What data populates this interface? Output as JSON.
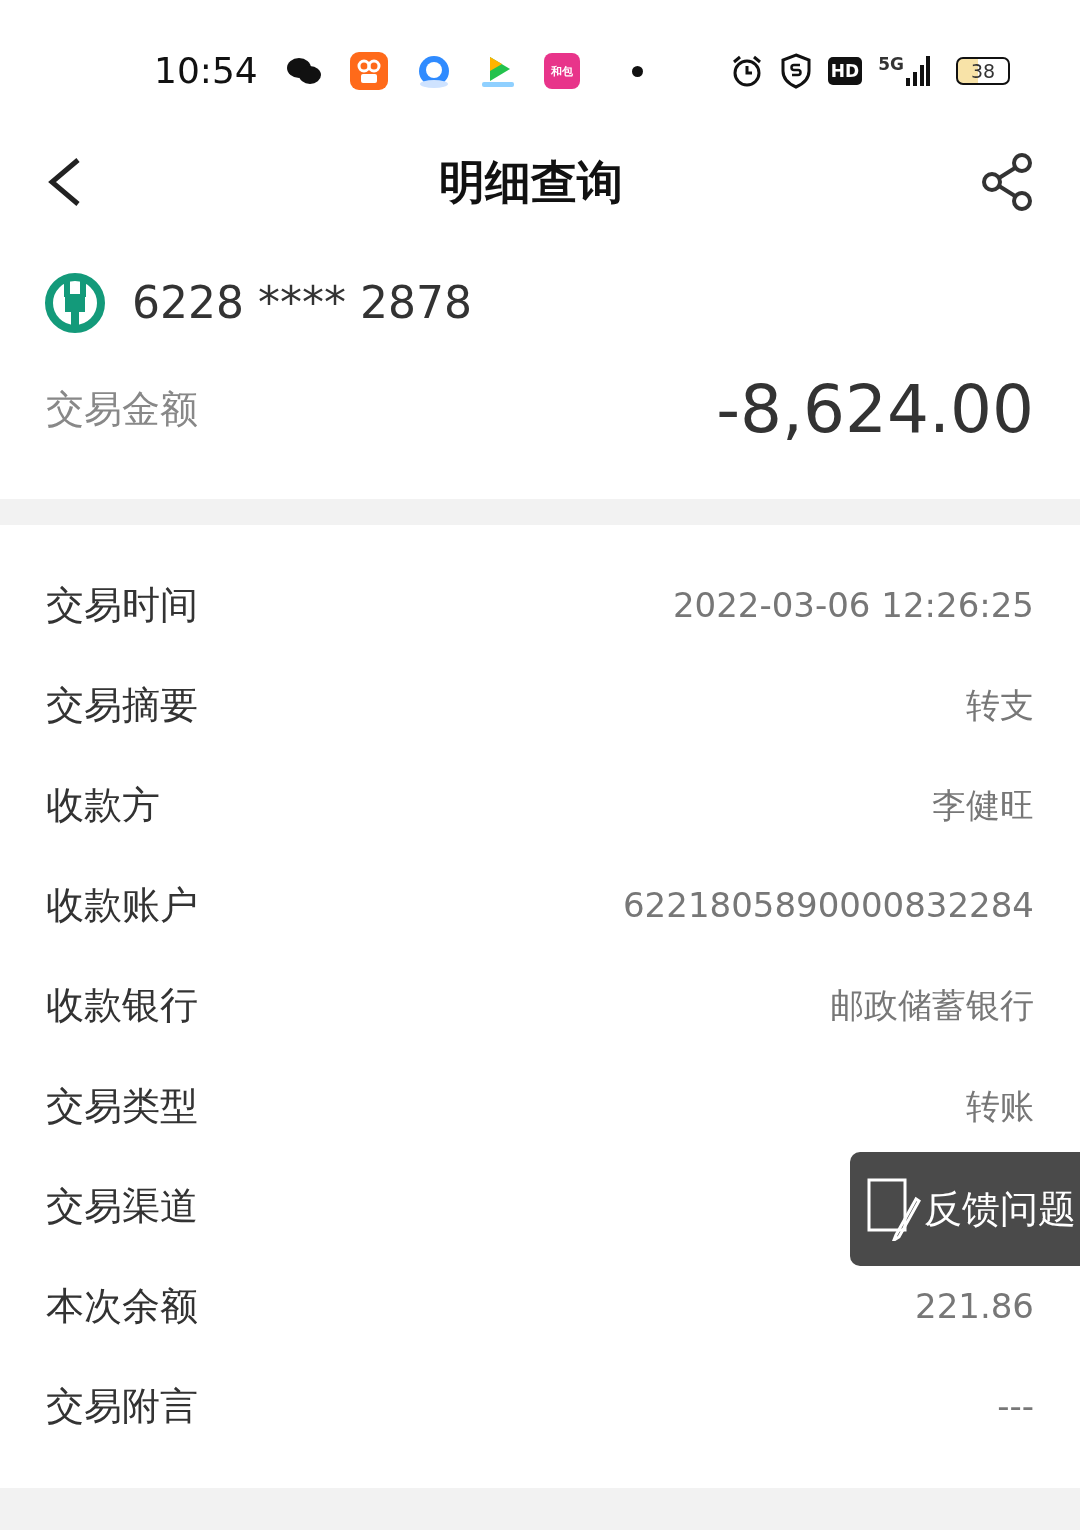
{
  "status_bar": {
    "time": "10:54",
    "app_badge": "和包",
    "hd": "HD",
    "network": "5G",
    "battery": "38"
  },
  "header": {
    "title": "明细查询"
  },
  "account": {
    "card_number": "6228 **** 2878"
  },
  "amount": {
    "label": "交易金额",
    "value": "-8,624.00"
  },
  "details": [
    {
      "label": "交易时间",
      "value": "2022-03-06 12:26:25"
    },
    {
      "label": "交易摘要",
      "value": "转支"
    },
    {
      "label": "收款方",
      "value": "李健旺"
    },
    {
      "label": "收款账户",
      "value": "6221805890000832284"
    },
    {
      "label": "收款银行",
      "value": "邮政储蓄银行"
    },
    {
      "label": "交易类型",
      "value": "转账"
    },
    {
      "label": "交易渠道"
    },
    {
      "label": "本次余额",
      "value": "221.86"
    },
    {
      "label": "交易附言",
      "value": "---"
    }
  ],
  "feedback_button": {
    "label": "反馈问题"
  }
}
